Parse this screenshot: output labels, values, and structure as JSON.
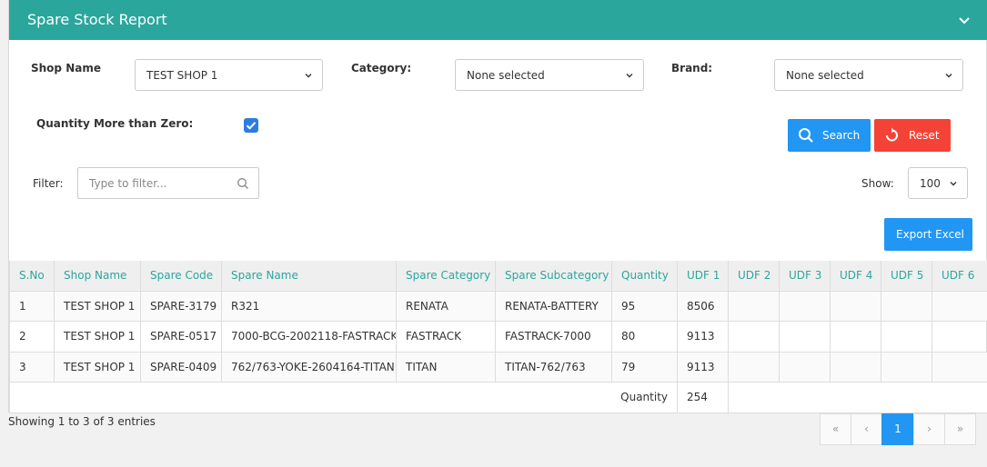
{
  "header": {
    "title": "Spare Stock Report"
  },
  "filters": {
    "shop_label": "Shop Name",
    "shop_value": "TEST SHOP 1",
    "category_label": "Category:",
    "category_value": "None selected",
    "brand_label": "Brand:",
    "brand_value": "None selected",
    "qty_label": "Quantity More than Zero:",
    "qty_checked": true,
    "search_label": "Search",
    "reset_label": "Reset",
    "filter_label": "Filter:",
    "filter_placeholder": "Type to filter...",
    "show_label": "Show:",
    "show_value": "100",
    "export_label": "Export Excel"
  },
  "table": {
    "columns": [
      "S.No",
      "Shop Name",
      "Spare Code",
      "Spare Name",
      "Spare Category",
      "Spare Subcategory",
      "Quantity",
      "UDF 1",
      "UDF 2",
      "UDF 3",
      "UDF 4",
      "UDF 5",
      "UDF 6"
    ],
    "rows": [
      [
        "1",
        "TEST SHOP 1",
        "SPARE-3179",
        "R321",
        "RENATA",
        "RENATA-BATTERY",
        "95",
        "8506",
        "",
        "",
        "",
        "",
        ""
      ],
      [
        "2",
        "TEST SHOP 1",
        "SPARE-0517",
        "7000-BCG-2002118-FASTRACK",
        "FASTRACK",
        "FASTRACK-7000",
        "80",
        "9113",
        "",
        "",
        "",
        "",
        ""
      ],
      [
        "3",
        "TEST SHOP 1",
        "SPARE-0409",
        "762/763-YOKE-2604164-TITAN",
        "TITAN",
        "TITAN-762/763",
        "79",
        "9113",
        "",
        "",
        "",
        "",
        ""
      ]
    ],
    "total_label": "Quantity",
    "total_value": "254"
  },
  "footer": {
    "showing_text": "Showing 1 to 3 of 3 entries",
    "pages": [
      "«",
      "‹",
      "1",
      "›",
      "»"
    ],
    "active_page": "1"
  },
  "colors": {
    "header": "#2ba69d",
    "primary": "#2196f3",
    "danger": "#f44336"
  }
}
